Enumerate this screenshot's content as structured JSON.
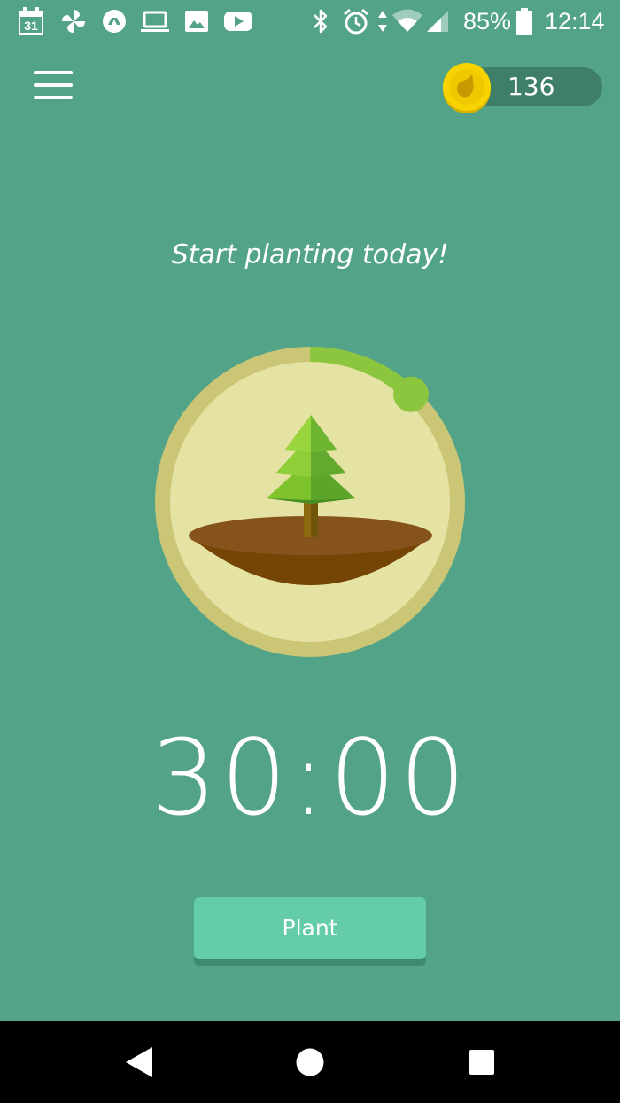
{
  "status_bar": {
    "battery_percent": "85%",
    "time": "12:14",
    "calendar_day": "31",
    "icons": [
      "calendar-icon",
      "pinwheel-icon",
      "drive-icon",
      "laptop-icon",
      "image-icon",
      "youtube-icon",
      "bluetooth-icon",
      "alarm-icon",
      "data-arrows-icon",
      "wifi-icon",
      "signal-icon",
      "battery-icon"
    ]
  },
  "header": {
    "menu_icon": "hamburger-menu-icon",
    "coins": "136",
    "coin_icon": "seed-coin-icon"
  },
  "main": {
    "headline": "Start planting today!",
    "timer": "30:00",
    "progress_fraction": 0.12,
    "plant_button_label": "Plant"
  },
  "nav_bar": {
    "icons": [
      "back-icon",
      "home-icon",
      "recents-icon"
    ]
  },
  "colors": {
    "background": "#52a387",
    "button": "#64cca8",
    "coin_pill": "#3f7f69",
    "coin": "#f5d000",
    "progress_arc": "#8cc63f",
    "dial_ring": "#cbc576",
    "dial_face": "#e5e3a4",
    "soil_top": "#86531d",
    "soil": "#744505"
  }
}
